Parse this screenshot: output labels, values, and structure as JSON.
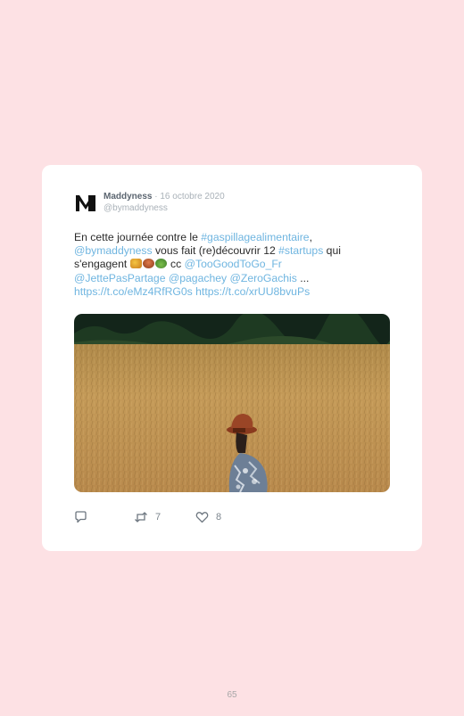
{
  "tweet": {
    "author_name": "Maddyness",
    "separator": "·",
    "date": "16 octobre 2020",
    "handle": "@bymaddyness",
    "text_segments": {
      "t1": "En cette journée contre le ",
      "l1": "#gaspillagealimentaire",
      "t2": ",",
      "l2": "@bymaddyness",
      "t3": " vous fait (re)découvrir 12 ",
      "l3": "#startups",
      "t4": " qui s'engagent ",
      "t5": " cc ",
      "l4": "@TooGoodToGo_Fr",
      "l5": "@JettePasPartage",
      "l6": "@pagachey",
      "l7": "@ZeroGachis",
      "t6": " ...",
      "l8": "https://t.co/eMz4RfRG0s",
      "l9": "https://t.co/xrUU8bvuPs"
    },
    "emojis": [
      "produce-emoji",
      "burger-emoji",
      "salad-emoji"
    ],
    "image_alt": "",
    "actions": {
      "reply_count": "",
      "retweet_count": "7",
      "like_count": "8"
    }
  },
  "icons": {
    "reply": "reply-icon",
    "retweet": "retweet-icon",
    "like": "heart-icon",
    "logo": "maddyness-logo"
  },
  "colors": {
    "background": "#fde1e4",
    "card": "#ffffff",
    "link": "#6fb5e0",
    "muted": "#a9b1b8"
  },
  "page_number": "65"
}
